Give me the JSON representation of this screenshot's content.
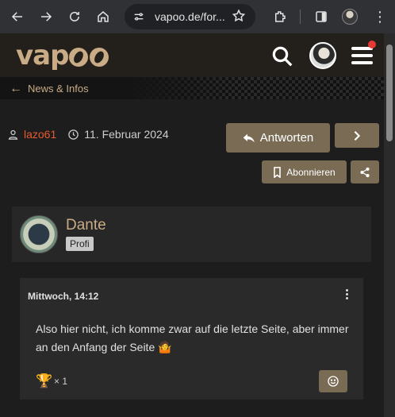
{
  "browser": {
    "url": "vapoo.de/for...",
    "icons": [
      "back-icon",
      "forward-icon",
      "reload-icon",
      "home-icon",
      "tune-icon",
      "star-icon",
      "extensions-icon",
      "sidepanel-icon",
      "profile-avatar",
      "kebab-menu-icon"
    ]
  },
  "site": {
    "logo_text": "vapoo",
    "accent": "#c9ab85",
    "button_color": "#7a6b55",
    "notification_color": "#e53935"
  },
  "breadcrumb": {
    "label": "News & Infos"
  },
  "thread": {
    "author": "lazo61",
    "date": "11. Februar 2024",
    "reply_label": "Antworten",
    "subscribe_label": "Abonnieren"
  },
  "post_author": {
    "name": "Dante",
    "rank": "Profi"
  },
  "post": {
    "time": "Mittwoch, 14:12",
    "text": "Also hier nicht, ich komme zwar auf die letzte Seite, aber immer an den Anfang der Seite 🤷",
    "reaction_count": "× 1"
  }
}
